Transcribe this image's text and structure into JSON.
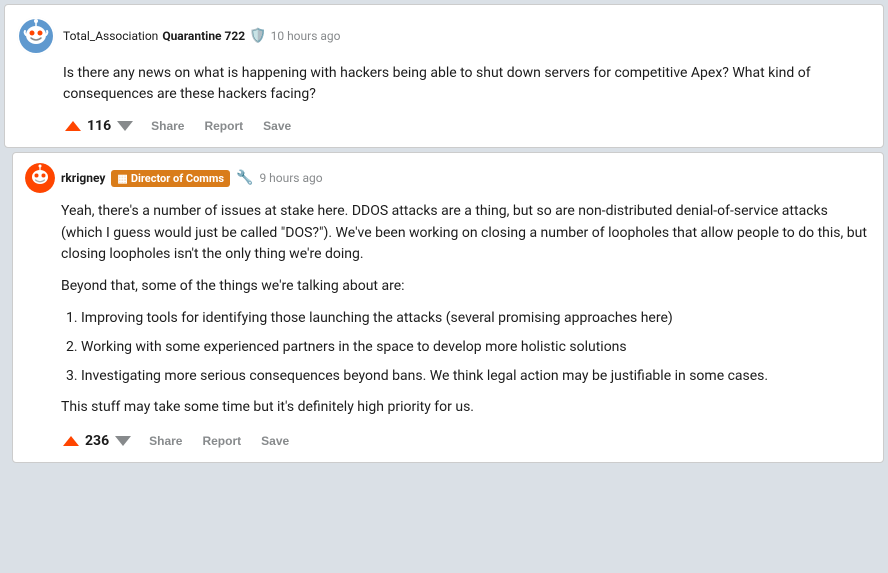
{
  "post": {
    "username_prefix": "Total_Association",
    "username_suffix": "Quarantine 722",
    "timestamp": "10 hours ago",
    "body": "Is there any news on what is happening with hackers being able to shut down servers for competitive Apex? What kind of consequences are these hackers facing?",
    "vote_count": "116",
    "actions": {
      "share": "Share",
      "report": "Report",
      "save": "Save"
    }
  },
  "comment": {
    "username": "rkrigney",
    "flair_icon": "▦",
    "flair_label": "Director of Comms",
    "wrench": "🔧",
    "timestamp": "9 hours ago",
    "paragraphs": {
      "p1": "Yeah, there's a number of issues at stake here. DDOS attacks are a thing, but so are non-distributed denial-of-service attacks (which I guess would just be called \"DOS?\"). We've been working on closing a number of loopholes that allow people to do this, but closing loopholes isn't the only thing we're doing.",
      "p2": "Beyond that, some of the things we're talking about are:",
      "list": [
        "Improving tools for identifying those launching the attacks (several promising approaches here)",
        "Working with some experienced partners in the space to develop more holistic solutions",
        "Investigating more serious consequences beyond bans. We think legal action may be justifiable in some cases."
      ],
      "p3": "This stuff may take some time but it's definitely high priority for us."
    },
    "vote_count": "236",
    "actions": {
      "share": "Share",
      "report": "Report",
      "save": "Save"
    }
  }
}
